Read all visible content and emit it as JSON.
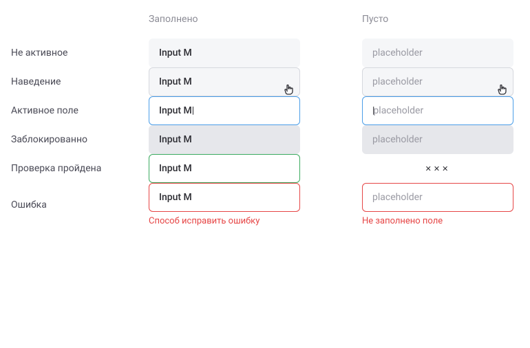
{
  "columns": {
    "filled": "Заполнено",
    "empty": "Пусто"
  },
  "rows": {
    "inactive": {
      "label": "Не активное",
      "filled_value": "Input M",
      "empty_placeholder": "placeholder"
    },
    "hover": {
      "label": "Наведение",
      "filled_value": "Input M",
      "empty_placeholder": "placeholder"
    },
    "active": {
      "label": "Активное поле",
      "filled_value": "Input M",
      "empty_placeholder": "placeholder"
    },
    "disabled": {
      "label": "Заблокированно",
      "filled_value": "Input M",
      "empty_placeholder": "placeholder"
    },
    "valid": {
      "label": "Проверка пройдена",
      "filled_value": "Input M",
      "empty_stars": "✕✕✕"
    },
    "error": {
      "label": "Ошибка",
      "filled_value": "Input M",
      "filled_error_msg": "Способ исправить ошибку",
      "empty_placeholder": "placeholder",
      "empty_error_msg": "Не заполнено поле"
    }
  }
}
